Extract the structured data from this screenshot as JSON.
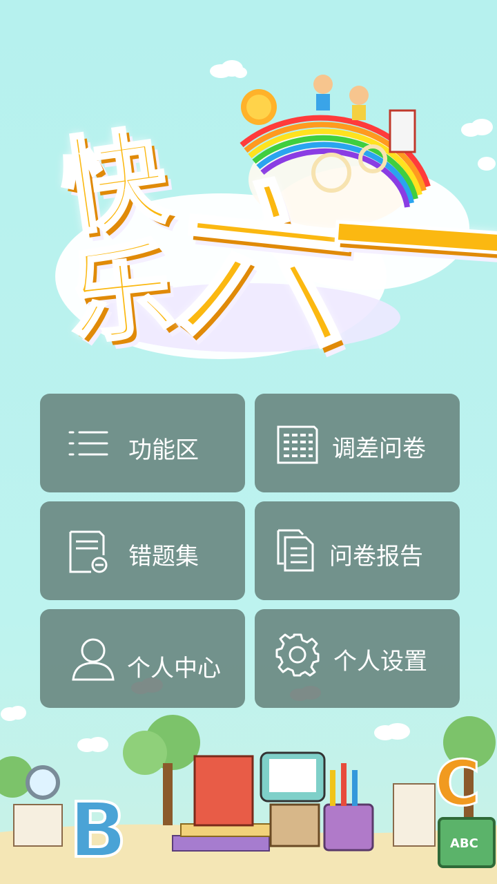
{
  "banner": {
    "chars": [
      "快",
      "乐",
      "六",
      "一"
    ]
  },
  "menu": {
    "items": [
      {
        "label": "功能区",
        "icon": "list-icon"
      },
      {
        "label": "调差问卷",
        "icon": "document-grid-icon"
      },
      {
        "label": "错题集",
        "icon": "document-minus-icon"
      },
      {
        "label": "问卷报告",
        "icon": "copy-document-icon"
      },
      {
        "label": "个人中心",
        "icon": "user-icon"
      },
      {
        "label": "个人设置",
        "icon": "gear-icon"
      }
    ]
  },
  "colors": {
    "background": "#b9f1ee",
    "tile": "#6e8c86",
    "banner": "#fbb811"
  }
}
